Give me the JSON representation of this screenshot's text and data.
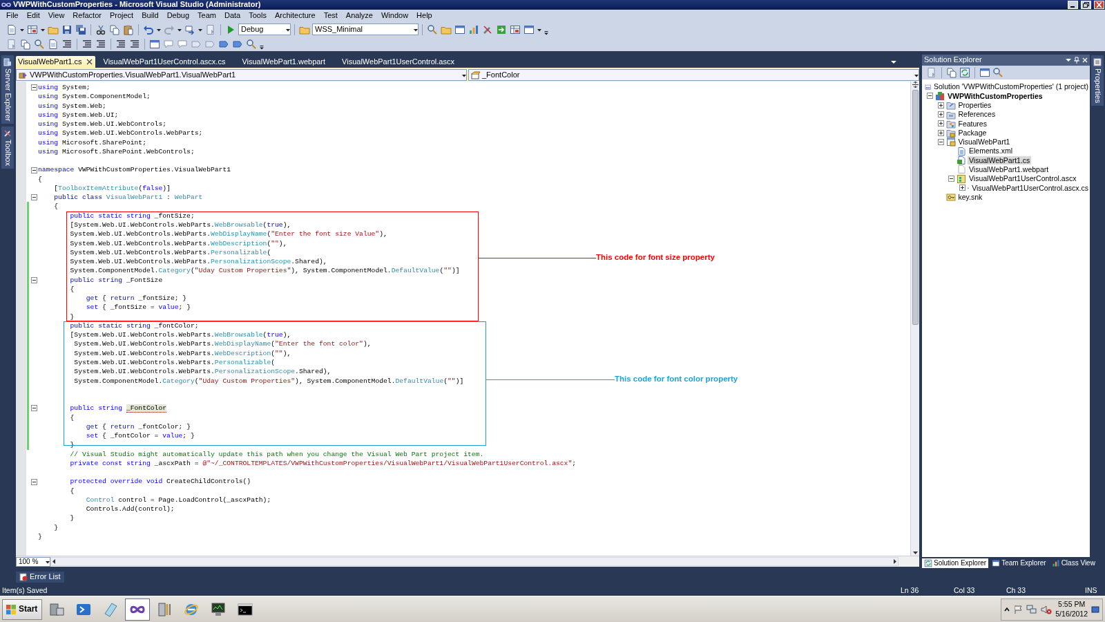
{
  "window": {
    "title": "VWPWithCustomProperties - Microsoft Visual Studio (Administrator)"
  },
  "menu": [
    "File",
    "Edit",
    "View",
    "Refactor",
    "Project",
    "Build",
    "Debug",
    "Team",
    "Data",
    "Tools",
    "Architecture",
    "Test",
    "Analyze",
    "Window",
    "Help"
  ],
  "toolbar": {
    "configuration": "Debug",
    "platform": "WSS_Minimal"
  },
  "side_tabs_left": [
    "Server Explorer",
    "Toolbox"
  ],
  "side_tabs_right": [
    "Properties"
  ],
  "editor": {
    "tabs": [
      {
        "label": "VisualWebPart1.cs",
        "selected": true
      },
      {
        "label": "VisualWebPart1UserControl.ascx.cs",
        "selected": false
      },
      {
        "label": "VisualWebPart1.webpart",
        "selected": false
      },
      {
        "label": "VisualWebPart1UserControl.ascx",
        "selected": false
      }
    ],
    "type_dropdown": "VWPWithCustomProperties.VisualWebPart1.VisualWebPart1",
    "member_dropdown": "_FontColor",
    "lines": [
      {
        "s": [
          {
            "kind": "keyword",
            "text": "using"
          },
          {
            "kind": "plain",
            "text": " System;"
          }
        ],
        "fold": true,
        "changed": false
      },
      {
        "s": [
          {
            "kind": "keyword",
            "text": "using"
          },
          {
            "kind": "plain",
            "text": " System.ComponentModel;"
          }
        ],
        "fold": false,
        "changed": false
      },
      {
        "s": [
          {
            "kind": "keyword",
            "text": "using"
          },
          {
            "kind": "plain",
            "text": " System.Web;"
          }
        ],
        "fold": false,
        "changed": false
      },
      {
        "s": [
          {
            "kind": "keyword",
            "text": "using"
          },
          {
            "kind": "plain",
            "text": " System.Web.UI;"
          }
        ],
        "fold": false,
        "changed": false
      },
      {
        "s": [
          {
            "kind": "keyword",
            "text": "using"
          },
          {
            "kind": "plain",
            "text": " System.Web.UI.WebControls;"
          }
        ],
        "fold": false,
        "changed": false
      },
      {
        "s": [
          {
            "kind": "keyword",
            "text": "using"
          },
          {
            "kind": "plain",
            "text": " System.Web.UI.WebControls.WebParts;"
          }
        ],
        "fold": false,
        "changed": false
      },
      {
        "s": [
          {
            "kind": "keyword",
            "text": "using"
          },
          {
            "kind": "plain",
            "text": " Microsoft.SharePoint;"
          }
        ],
        "fold": false,
        "changed": false
      },
      {
        "s": [
          {
            "kind": "keyword",
            "text": "using"
          },
          {
            "kind": "plain",
            "text": " Microsoft.SharePoint.WebControls;"
          }
        ],
        "fold": false,
        "changed": false
      },
      {
        "fold": false,
        "changed": false
      },
      {
        "s": [
          {
            "kind": "keyword",
            "text": "namespace"
          },
          {
            "kind": "plain",
            "text": " VWPWithCustomProperties.VisualWebPart1"
          }
        ],
        "fold": true,
        "changed": false
      },
      {
        "s": [
          {
            "kind": "plain",
            "text": "{"
          }
        ],
        "fold": false,
        "changed": false
      },
      {
        "s": [
          {
            "kind": "plain",
            "text": "    ["
          },
          {
            "kind": "type",
            "text": "ToolboxItemAttribute"
          },
          {
            "kind": "plain",
            "text": "("
          },
          {
            "kind": "keyword",
            "text": "false"
          },
          {
            "kind": "plain",
            "text": ")]"
          }
        ],
        "fold": false,
        "changed": false
      },
      {
        "s": [
          {
            "kind": "keyword",
            "text": "    public class "
          },
          {
            "kind": "type",
            "text": "VisualWebPart1"
          },
          {
            "kind": "plain",
            "text": " : "
          },
          {
            "kind": "type",
            "text": "WebPart"
          }
        ],
        "fold": true,
        "changed": false
      },
      {
        "s": [
          {
            "kind": "plain",
            "text": "    {"
          }
        ],
        "fold": false,
        "changed": true
      },
      {
        "s": [
          {
            "kind": "keyword",
            "text": "        public static string"
          },
          {
            "kind": "plain",
            "text": " _fontSize;"
          }
        ],
        "fold": false,
        "changed": true
      },
      {
        "s": [
          {
            "kind": "plain",
            "text": "        [System.Web.UI.WebControls.WebParts."
          },
          {
            "kind": "type",
            "text": "WebBrowsable"
          },
          {
            "kind": "plain",
            "text": "("
          },
          {
            "kind": "keyword",
            "text": "true"
          },
          {
            "kind": "plain",
            "text": "),"
          }
        ],
        "fold": false,
        "changed": true
      },
      {
        "s": [
          {
            "kind": "plain",
            "text": "        System.Web.UI.WebControls.WebParts."
          },
          {
            "kind": "type",
            "text": "WebDisplayName"
          },
          {
            "kind": "plain",
            "text": "("
          },
          {
            "kind": "string",
            "text": "\"Enter the font size Value\""
          },
          {
            "kind": "plain",
            "text": "),"
          }
        ],
        "fold": false,
        "changed": true
      },
      {
        "s": [
          {
            "kind": "plain",
            "text": "        System.Web.UI.WebControls.WebParts."
          },
          {
            "kind": "type",
            "text": "WebDescription"
          },
          {
            "kind": "plain",
            "text": "("
          },
          {
            "kind": "string",
            "text": "\"\""
          },
          {
            "kind": "plain",
            "text": "),"
          }
        ],
        "fold": false,
        "changed": true
      },
      {
        "s": [
          {
            "kind": "plain",
            "text": "        System.Web.UI.WebControls.WebParts."
          },
          {
            "kind": "type",
            "text": "Personalizable"
          },
          {
            "kind": "plain",
            "text": "("
          }
        ],
        "fold": false,
        "changed": true
      },
      {
        "s": [
          {
            "kind": "plain",
            "text": "        System.Web.UI.WebControls.WebParts."
          },
          {
            "kind": "type",
            "text": "PersonalizationScope"
          },
          {
            "kind": "plain",
            "text": ".Shared),"
          }
        ],
        "fold": false,
        "changed": true
      },
      {
        "s": [
          {
            "kind": "plain",
            "text": "        System.ComponentModel."
          },
          {
            "kind": "type",
            "text": "Category"
          },
          {
            "kind": "plain",
            "text": "("
          },
          {
            "kind": "string",
            "text": "\"Uday Custom Properties\""
          },
          {
            "kind": "plain",
            "text": "), System.ComponentModel."
          },
          {
            "kind": "type",
            "text": "DefaultValue"
          },
          {
            "kind": "plain",
            "text": "("
          },
          {
            "kind": "string",
            "text": "\"\""
          },
          {
            "kind": "plain",
            "text": ")]"
          }
        ],
        "fold": false,
        "changed": true
      },
      {
        "s": [
          {
            "kind": "keyword",
            "text": "        public string"
          },
          {
            "kind": "plain",
            "text": " _FontSize"
          }
        ],
        "fold": true,
        "changed": true
      },
      {
        "s": [
          {
            "kind": "plain",
            "text": "        {"
          }
        ],
        "fold": false,
        "changed": true
      },
      {
        "s": [
          {
            "kind": "keyword",
            "text": "            get"
          },
          {
            "kind": "plain",
            "text": " { "
          },
          {
            "kind": "keyword",
            "text": "return"
          },
          {
            "kind": "plain",
            "text": " _fontSize; }"
          }
        ],
        "fold": false,
        "changed": true
      },
      {
        "s": [
          {
            "kind": "keyword",
            "text": "            set"
          },
          {
            "kind": "plain",
            "text": " { _fontSize = "
          },
          {
            "kind": "keyword",
            "text": "value"
          },
          {
            "kind": "plain",
            "text": "; }"
          }
        ],
        "fold": false,
        "changed": true
      },
      {
        "s": [
          {
            "kind": "plain",
            "text": "        }"
          }
        ],
        "fold": false,
        "changed": true
      },
      {
        "s": [
          {
            "kind": "keyword",
            "text": "        public static string"
          },
          {
            "kind": "plain",
            "text": " _fontColor;"
          }
        ],
        "fold": false,
        "changed": true
      },
      {
        "s": [
          {
            "kind": "plain",
            "text": "        [System.Web.UI.WebControls.WebParts."
          },
          {
            "kind": "type",
            "text": "WebBrowsable"
          },
          {
            "kind": "plain",
            "text": "("
          },
          {
            "kind": "keyword",
            "text": "true"
          },
          {
            "kind": "plain",
            "text": "),"
          }
        ],
        "fold": false,
        "changed": true
      },
      {
        "s": [
          {
            "kind": "plain",
            "text": "         System.Web.UI.WebControls.WebParts."
          },
          {
            "kind": "type",
            "text": "WebDisplayName"
          },
          {
            "kind": "plain",
            "text": "("
          },
          {
            "kind": "string",
            "text": "\"Enter the font color\""
          },
          {
            "kind": "plain",
            "text": "),"
          }
        ],
        "fold": false,
        "changed": true
      },
      {
        "s": [
          {
            "kind": "plain",
            "text": "         System.Web.UI.WebControls.WebParts."
          },
          {
            "kind": "type",
            "text": "WebDescription"
          },
          {
            "kind": "plain",
            "text": "("
          },
          {
            "kind": "string",
            "text": "\"\""
          },
          {
            "kind": "plain",
            "text": "),"
          }
        ],
        "fold": false,
        "changed": true
      },
      {
        "s": [
          {
            "kind": "plain",
            "text": "         System.Web.UI.WebControls.WebParts."
          },
          {
            "kind": "type",
            "text": "Personalizable"
          },
          {
            "kind": "plain",
            "text": "("
          }
        ],
        "fold": false,
        "changed": true
      },
      {
        "s": [
          {
            "kind": "plain",
            "text": "         System.Web.UI.WebControls.WebParts."
          },
          {
            "kind": "type",
            "text": "PersonalizationScope"
          },
          {
            "kind": "plain",
            "text": ".Shared),"
          }
        ],
        "fold": false,
        "changed": true
      },
      {
        "s": [
          {
            "kind": "plain",
            "text": "         System.ComponentModel."
          },
          {
            "kind": "type",
            "text": "Category"
          },
          {
            "kind": "plain",
            "text": "("
          },
          {
            "kind": "string",
            "text": "\"Uday Custom Properties\""
          },
          {
            "kind": "plain",
            "text": "), System.ComponentModel."
          },
          {
            "kind": "type",
            "text": "DefaultValue"
          },
          {
            "kind": "plain",
            "text": "("
          },
          {
            "kind": "string",
            "text": "\"\""
          },
          {
            "kind": "plain",
            "text": ")]"
          }
        ],
        "fold": false,
        "changed": true
      },
      {
        "fold": false,
        "changed": true
      },
      {
        "fold": false,
        "changed": true
      },
      {
        "s": [
          {
            "kind": "keyword",
            "text": "        public string "
          },
          {
            "kind": "highlight",
            "text": "_FontColor"
          }
        ],
        "fold": true,
        "changed": true
      },
      {
        "s": [
          {
            "kind": "plain",
            "text": "        {"
          }
        ],
        "fold": false,
        "changed": true
      },
      {
        "s": [
          {
            "kind": "keyword",
            "text": "            get"
          },
          {
            "kind": "plain",
            "text": " { "
          },
          {
            "kind": "keyword",
            "text": "return"
          },
          {
            "kind": "plain",
            "text": " _fontColor; }"
          }
        ],
        "fold": false,
        "changed": true
      },
      {
        "s": [
          {
            "kind": "keyword",
            "text": "            set"
          },
          {
            "kind": "plain",
            "text": " { _fontColor = "
          },
          {
            "kind": "keyword",
            "text": "value"
          },
          {
            "kind": "plain",
            "text": "; }"
          }
        ],
        "fold": false,
        "changed": true
      },
      {
        "s": [
          {
            "kind": "plain",
            "text": "        }"
          }
        ],
        "fold": false,
        "changed": true
      },
      {
        "s": [
          {
            "kind": "comment",
            "text": "        // Visual Studio might automatically update this path when you change the Visual Web Part project item."
          }
        ],
        "fold": false,
        "changed": false
      },
      {
        "s": [
          {
            "kind": "keyword",
            "text": "        private const string"
          },
          {
            "kind": "plain",
            "text": " _ascxPath = "
          },
          {
            "kind": "string",
            "text": "@\"~/_CONTROLTEMPLATES/VWPWithCustomProperties/VisualWebPart1/VisualWebPart1UserControl.ascx\""
          },
          {
            "kind": "plain",
            "text": ";"
          }
        ],
        "fold": false,
        "changed": false
      },
      {
        "fold": false,
        "changed": false
      },
      {
        "s": [
          {
            "kind": "keyword",
            "text": "        protected override void"
          },
          {
            "kind": "plain",
            "text": " CreateChildControls()"
          }
        ],
        "fold": true,
        "changed": false
      },
      {
        "s": [
          {
            "kind": "plain",
            "text": "        {"
          }
        ],
        "fold": false,
        "changed": false
      },
      {
        "s": [
          {
            "kind": "type",
            "text": "            Control"
          },
          {
            "kind": "plain",
            "text": " control = Page.LoadControl(_ascxPath);"
          }
        ],
        "fold": false,
        "changed": false
      },
      {
        "s": [
          {
            "kind": "plain",
            "text": "            Controls.Add(control);"
          }
        ],
        "fold": false,
        "changed": false
      },
      {
        "s": [
          {
            "kind": "plain",
            "text": "        }"
          }
        ],
        "fold": false,
        "changed": false
      },
      {
        "s": [
          {
            "kind": "plain",
            "text": "    }"
          }
        ],
        "fold": false,
        "changed": false
      },
      {
        "s": [
          {
            "kind": "plain",
            "text": "}"
          }
        ],
        "fold": false,
        "changed": false
      }
    ],
    "annotations": [
      {
        "text": "This code for font size property",
        "color": "#ff0000"
      },
      {
        "text": "This code for font color property",
        "color": "#1ea0dc"
      }
    ],
    "zoom": "100 %"
  },
  "solution_explorer": {
    "title": "Solution Explorer",
    "tree": [
      {
        "label": "Solution 'VWPWithCustomProperties' (1 project)",
        "kind": "solution",
        "selected": false,
        "children": [
          {
            "label": "VWPWithCustomProperties",
            "kind": "project",
            "expanded": true,
            "selected": false,
            "children": [
              {
                "label": "Properties",
                "kind": "properties",
                "expanded": false,
                "selected": false
              },
              {
                "label": "References",
                "kind": "references",
                "expanded": false,
                "selected": false
              },
              {
                "label": "Features",
                "kind": "features",
                "expanded": false,
                "selected": false
              },
              {
                "label": "Package",
                "kind": "package",
                "expanded": false,
                "selected": false
              },
              {
                "label": "VisualWebPart1",
                "kind": "webpart",
                "expanded": true,
                "selected": false,
                "children": [
                  {
                    "label": "Elements.xml",
                    "kind": "xml",
                    "selected": false
                  },
                  {
                    "label": "VisualWebPart1.cs",
                    "kind": "cs",
                    "selected": true
                  },
                  {
                    "label": "VisualWebPart1.webpart",
                    "kind": "file",
                    "selected": false
                  },
                  {
                    "label": "VisualWebPart1UserControl.ascx",
                    "kind": "ascx",
                    "expanded": true,
                    "selected": false,
                    "children": [
                      {
                        "label": "VisualWebPart1UserControl.ascx.cs",
                        "kind": "cs",
                        "expanded": false,
                        "selected": false
                      }
                    ]
                  }
                ]
              },
              {
                "label": "key.snk",
                "kind": "key",
                "selected": false
              }
            ]
          }
        ]
      }
    ],
    "tabs": [
      {
        "label": "Solution Explorer",
        "selected": true
      },
      {
        "label": "Team Explorer",
        "selected": false
      },
      {
        "label": "Class View",
        "selected": false
      }
    ]
  },
  "error_list": "Error List",
  "status_bar": {
    "message": "Item(s) Saved",
    "line": "Ln 36",
    "column": "Col 33",
    "char": "Ch 33",
    "mode": "INS"
  },
  "taskbar": {
    "start": "Start",
    "apps": [
      {
        "selected": false
      },
      {
        "selected": false
      },
      {
        "selected": false
      },
      {
        "selected": true
      },
      {
        "selected": false
      },
      {
        "selected": false
      },
      {
        "selected": false
      },
      {
        "selected": false
      }
    ],
    "time": "5:55 PM",
    "date": "5/16/2012"
  }
}
